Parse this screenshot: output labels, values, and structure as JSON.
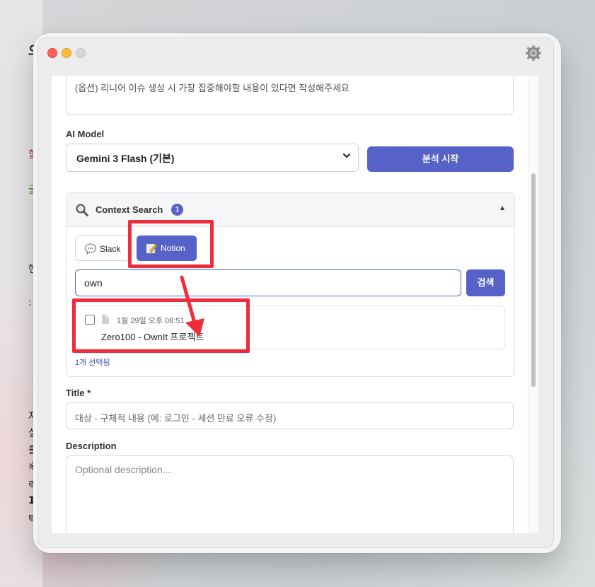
{
  "background": {
    "fragments": [
      "오",
      "할",
      "글",
      "헨",
      ":",
      "자",
      "실",
      "를",
      "※",
      "력",
      "1",
      "탁"
    ]
  },
  "window": {
    "gear_icon": "gear-icon"
  },
  "form": {
    "focus_textarea_placeholder": "(옵션) 리니어 이슈 생성 시 가장 집중해야할 내용이 있다면 작성해주세요",
    "ai_model_label": "AI Model",
    "ai_model_selected": "Gemini 3 Flash (기본)",
    "analyze_button": "분석 시작",
    "title_label": "Title *",
    "title_placeholder": "대상 - 구체적 내용 (예: 로그인 - 세션 만료 오류 수정)",
    "description_label": "Description",
    "description_placeholder": "Optional description..."
  },
  "context_search": {
    "title": "Context Search",
    "badge_count": "1",
    "collapse_glyph": "▲",
    "sources": [
      {
        "label": "Slack",
        "icon": "speech-bubble-icon"
      },
      {
        "label": "Notion",
        "icon": "memo-icon",
        "active": true
      }
    ],
    "query": "own",
    "search_button": "검색",
    "results": [
      {
        "date": "1월 29일 오후 08:51",
        "title": "Zero100 - OwnIt 프로젝트",
        "checked": false
      }
    ],
    "selected_text": "1개 선택됨"
  },
  "colors": {
    "accent": "#5662c8",
    "highlight": "#ee2c3c"
  }
}
